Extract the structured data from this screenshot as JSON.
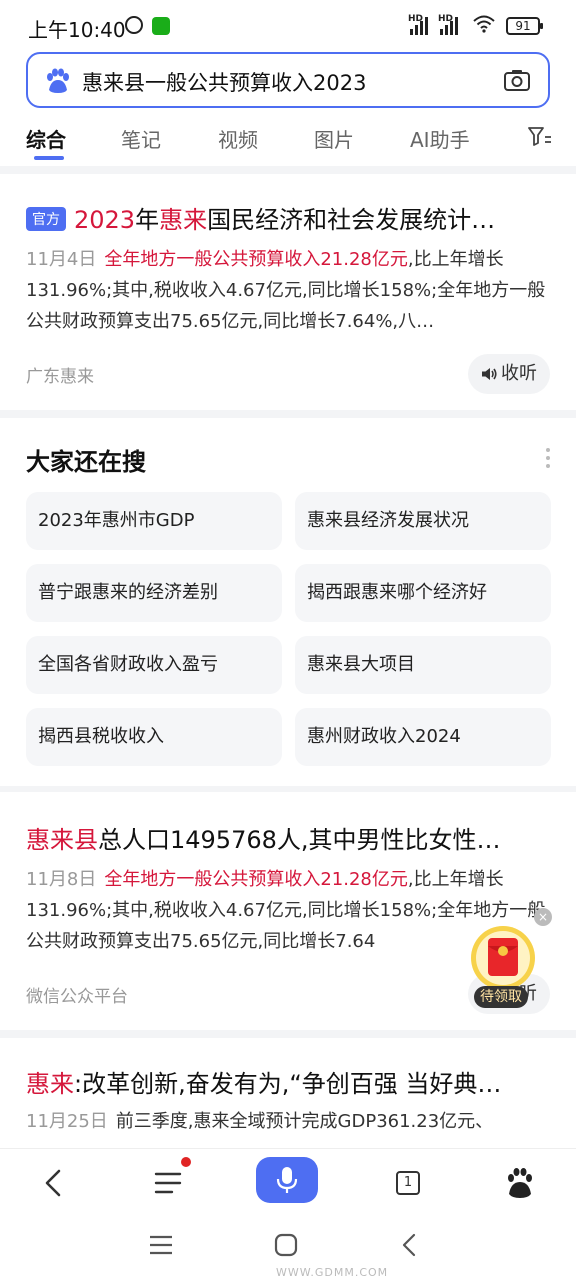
{
  "status_bar": {
    "time": "上午10:40",
    "battery": "91",
    "hd1": "HD",
    "hd2": "HD"
  },
  "search": {
    "query": "惠来县一般公共预算收入2023"
  },
  "tabs": [
    {
      "label": "综合",
      "active": true
    },
    {
      "label": "笔记"
    },
    {
      "label": "视频"
    },
    {
      "label": "图片"
    },
    {
      "label": "AI助手"
    }
  ],
  "results": [
    {
      "badge": "官方",
      "title_hl1": "2023",
      "title_p1": "年",
      "title_hl2": "惠来",
      "title_p2": "国民经济和社会发展统计…",
      "date": "11月4日",
      "snippet_hl": "全年地方一般公共预算收入21.28亿元",
      "snippet_rest": ",比上年增长131.96%;其中,税收收入4.67亿元,同比增长158%;全年地方一般公共财政预算支出75.65亿元,同比增长7.64%,八…",
      "source": "广东惠来",
      "listen": "收听"
    },
    {
      "title_hl": "惠来县",
      "title_rest": "总人口1495768人,其中男性比女性…",
      "date": "11月8日",
      "snippet_hl": "全年地方一般公共预算收入21.28亿元",
      "snippet_rest": ",比上年增长131.96%;其中,税收收入4.67亿元,同比增长158%;全年地方一般公共财政预算支出75.65亿元,同比增长7.64",
      "source": "微信公众平台",
      "listen": "收听"
    },
    {
      "title_hl": "惠来",
      "title_rest": ":改革创新,奋发有为,“争创百强 当好典…",
      "date": "11月25日",
      "snippet": "前三季度,惠来全域预计完成GDP361.23亿元、"
    }
  ],
  "related": {
    "title": "大家还在搜",
    "items": [
      "2023年惠州市GDP",
      "惠来县经济发展状况",
      "普宁跟惠来的经济差别",
      "揭西跟惠来哪个经济好",
      "全国各省财政收入盈亏",
      "惠来县大项目",
      "揭西县税收收入",
      "惠州财政收入2024"
    ]
  },
  "red_packet": {
    "label": "待领取"
  },
  "bottom_nav": {
    "tab_count": "1"
  },
  "watermark": "WWW.GDMM.COM",
  "colors": {
    "accent": "#4e6ef2",
    "highlight": "#d5173b"
  }
}
